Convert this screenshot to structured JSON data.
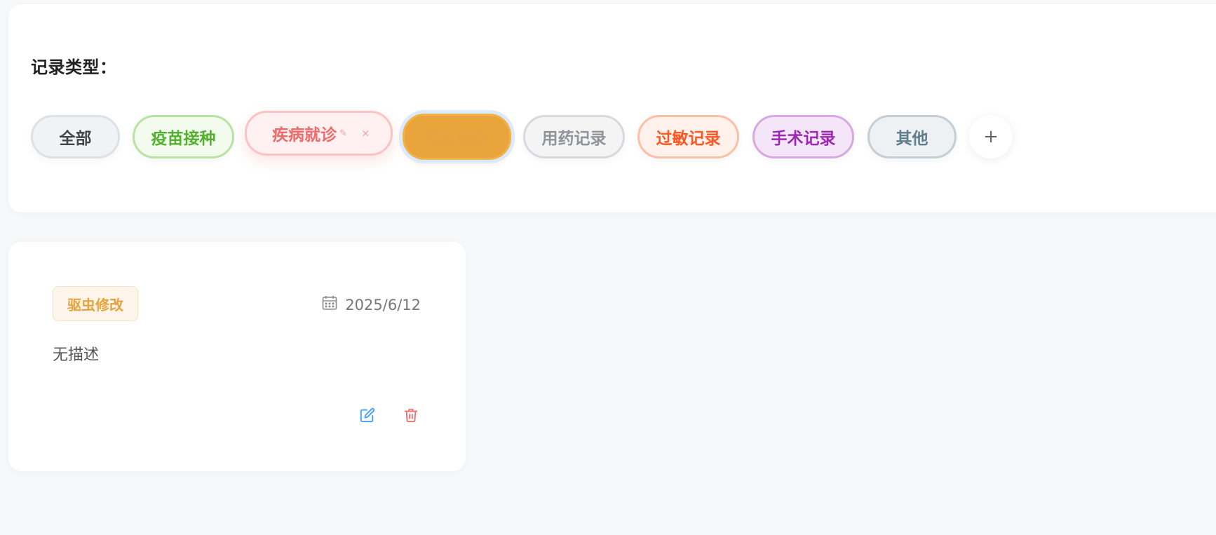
{
  "filter": {
    "title": "记录类型：",
    "tags": [
      {
        "label": "全部"
      },
      {
        "label": "疫苗接种"
      },
      {
        "label": "疾病就诊"
      },
      {
        "label": "驱虫修改"
      },
      {
        "label": "用药记录"
      },
      {
        "label": "过敏记录"
      },
      {
        "label": "手术记录"
      },
      {
        "label": "其他"
      }
    ],
    "add_label": "+",
    "edit_icon": "✎",
    "close_icon": "×"
  },
  "record": {
    "tag": "驱虫修改",
    "date": "2025/6/12",
    "description": "无描述"
  },
  "colors": {
    "vaccine": "#52b12c",
    "disease": "#f06a6a",
    "deworm": "#e9a43c",
    "allergy": "#ff5722",
    "surgery": "#9c27b0",
    "other": "#607d8b",
    "edit_icon": "#409eff",
    "delete_icon": "#f56c6c"
  },
  "icons": {
    "calendar": "calendar-icon",
    "edit": "edit-icon",
    "delete": "trash-icon"
  }
}
